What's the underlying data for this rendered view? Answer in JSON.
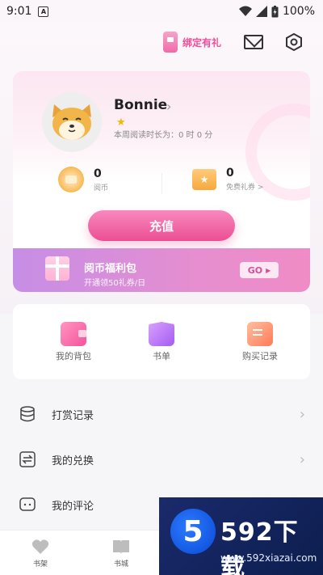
{
  "status": {
    "time": "9:01",
    "notif_icon": "A",
    "battery": "100%"
  },
  "header": {
    "bind_label": "绑定有礼"
  },
  "profile": {
    "username": "Bonnie",
    "read_time": "本周阅读时长为：0 时 0 分",
    "coins": {
      "value": "0",
      "label": "阅币"
    },
    "coupons": {
      "value": "0",
      "label": "免费礼券 >"
    },
    "recharge_label": "充值"
  },
  "promo": {
    "title": "阅币福利包",
    "subtitle": "开通领50礼券/日",
    "go": "GO"
  },
  "quick": [
    {
      "label": "我的背包"
    },
    {
      "label": "书单"
    },
    {
      "label": "购买记录"
    }
  ],
  "menu": [
    {
      "label": "打赏记录"
    },
    {
      "label": "我的兑换"
    },
    {
      "label": "我的评论"
    }
  ],
  "tabs": [
    {
      "label": "书架"
    },
    {
      "label": "书城"
    }
  ],
  "watermark": {
    "badge": "5",
    "title": "592下载",
    "url": "www.592xiazai.com"
  },
  "colors": {
    "accent": "#ec4e94",
    "promo_start": "#c68ee6",
    "promo_end": "#f08cc5"
  }
}
